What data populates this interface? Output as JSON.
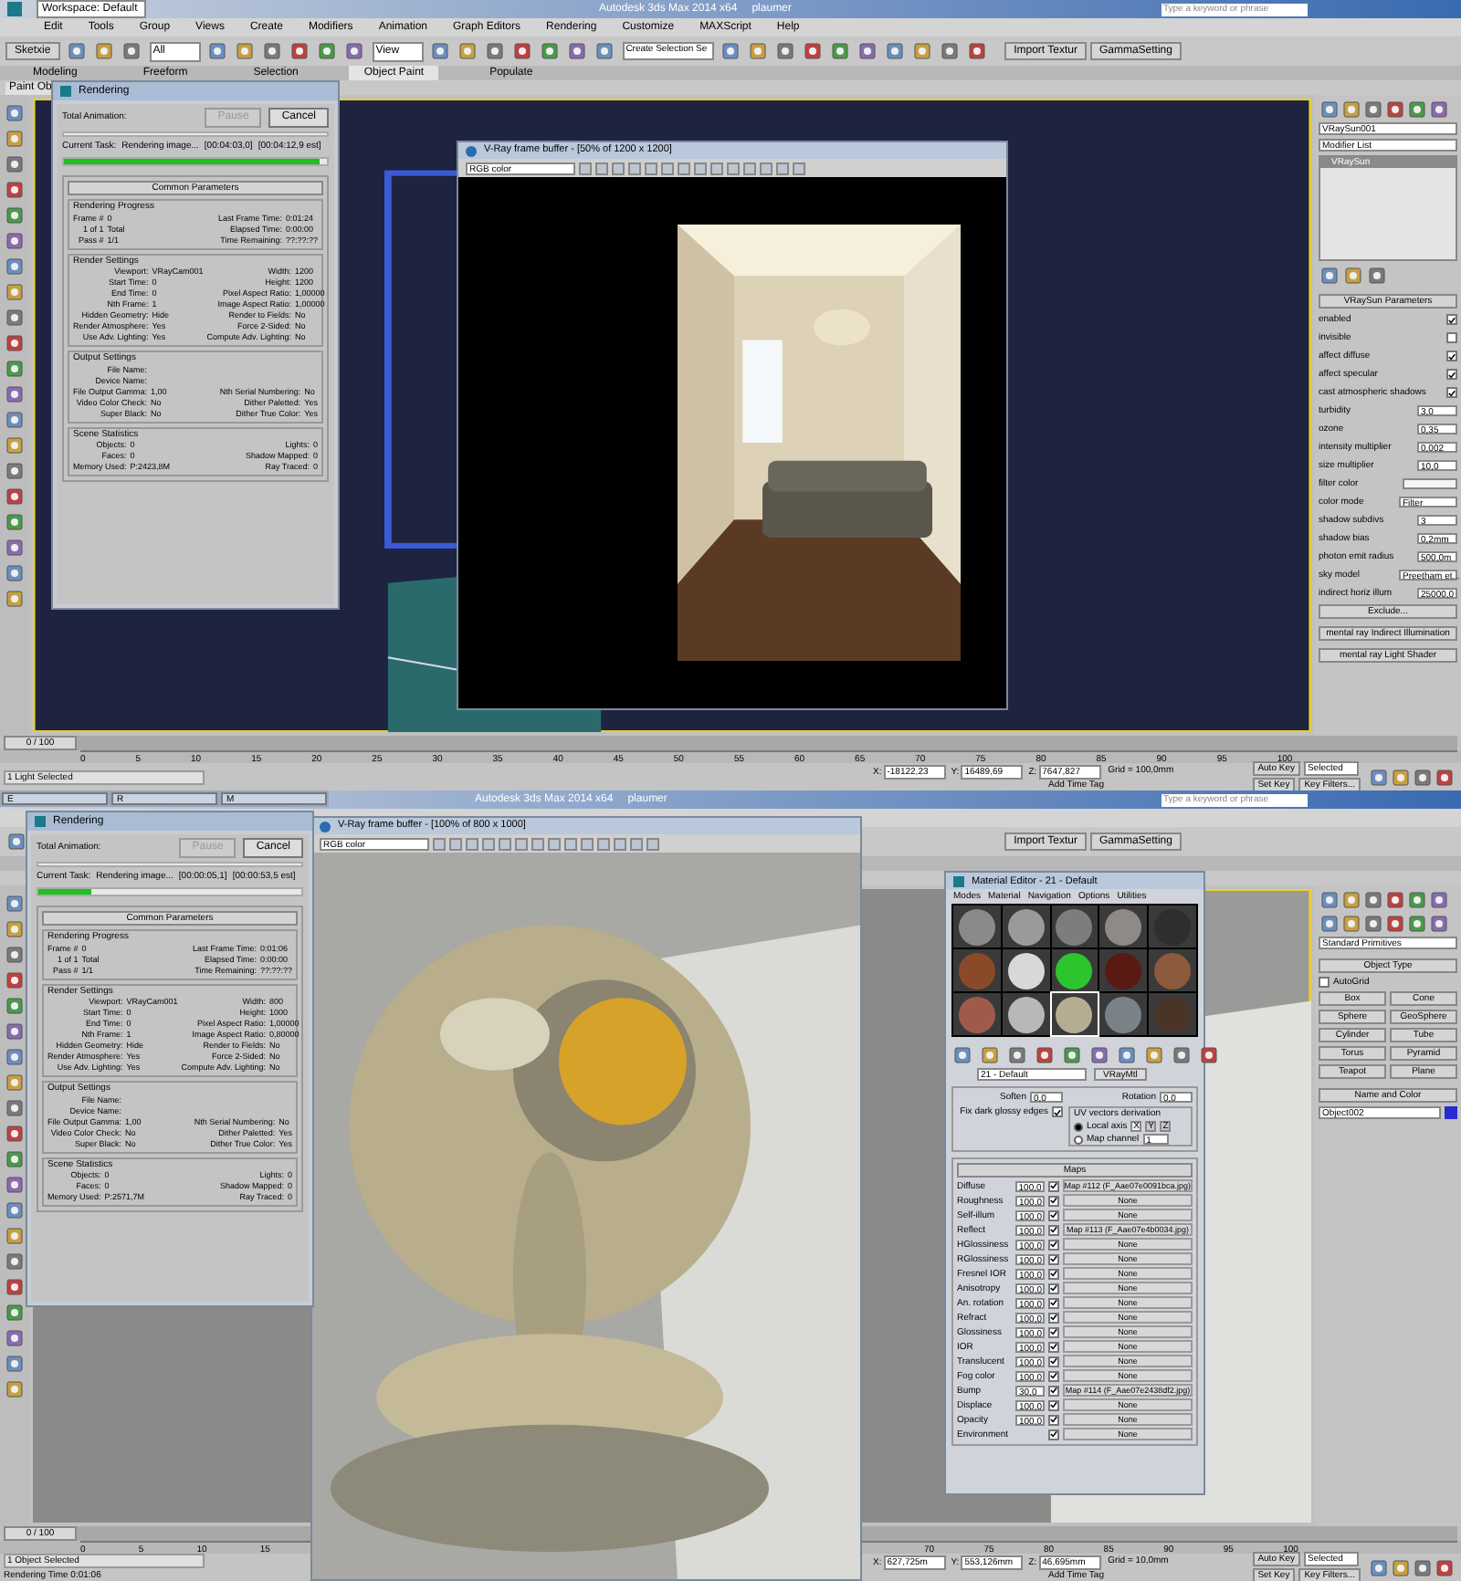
{
  "halves": [
    {
      "title_bar": {
        "workspace": "Workspace: Default",
        "title": "Autodesk 3ds Max 2014 x64",
        "user": "plaumer",
        "search_placeholder": "Type a keyword or phrase"
      },
      "menu": [
        "Edit",
        "Tools",
        "Group",
        "Views",
        "Create",
        "Modifiers",
        "Animation",
        "Graph Editors",
        "Rendering",
        "Customize",
        "MAXScript",
        "Help"
      ],
      "toolbar": {
        "sketch": "Sketxie",
        "filter": "All",
        "view": "View",
        "selection_set": "Create Selection Se",
        "buttons": [
          "Import Textur",
          "GammaSetting"
        ]
      },
      "ribbon": [
        {
          "label": "Modeling",
          "selected": false
        },
        {
          "label": "Freeform",
          "selected": false
        },
        {
          "label": "Selection",
          "selected": false
        },
        {
          "label": "Object Paint",
          "selected": true
        },
        {
          "label": "Populate",
          "selected": false
        }
      ],
      "paint_label": "Paint Ob",
      "viewport": {
        "kind": "dark"
      },
      "render_dialog": {
        "title": "Rendering",
        "total": "Total Animation:",
        "pause": {
          "label": "Pause",
          "disabled": true
        },
        "cancel": "Cancel",
        "task_label": "Current Task:",
        "task": "Rendering image...",
        "total_bar": {
          "level": 0
        },
        "elapsed": "[00:04:03,0]",
        "estimate": "[00:04:12,9 est]",
        "progress": {
          "level": 0.97
        },
        "heading": "Common Parameters",
        "groups": [
          {
            "title": "Rendering Progress",
            "rows": [
              [
                "Frame #",
                "0",
                "Last Frame Time:",
                "0:01:24"
              ],
              [
                "1 of 1",
                "Total",
                "Elapsed Time:",
                "0:00:00"
              ],
              [
                "Pass #",
                "1/1",
                "Time Remaining:",
                "??:??:??"
              ]
            ]
          },
          {
            "title": "Render Settings",
            "rows": [
              [
                "Viewport:",
                "VRayCam001",
                "Width:",
                "1200"
              ],
              [
                "Start Time:",
                "0",
                "Height:",
                "1200"
              ],
              [
                "End Time:",
                "0",
                "Pixel Aspect Ratio:",
                "1,00000"
              ],
              [
                "Nth Frame:",
                "1",
                "Image Aspect Ratio:",
                "1,00000"
              ],
              [
                "Hidden Geometry:",
                "Hide",
                "Render to Fields:",
                "No"
              ],
              [
                "Render Atmosphere:",
                "Yes",
                "Force 2-Sided:",
                "No"
              ],
              [
                "Use Adv. Lighting:",
                "Yes",
                "Compute Adv. Lighting:",
                "No"
              ]
            ]
          },
          {
            "title": "Output Settings",
            "rows": [
              [
                "File Name:"
              ],
              [
                "Device Name:"
              ],
              [
                "File Output Gamma:",
                "1,00",
                "Nth Serial Numbering:",
                "No"
              ],
              [
                "Video Color Check:",
                "No",
                "Dither Paletted:",
                "Yes"
              ],
              [
                "Super Black:",
                "No",
                "Dither True Color:",
                "Yes"
              ]
            ]
          },
          {
            "title": "Scene Statistics",
            "rows": [
              [
                "Objects:",
                "0",
                "Lights:",
                "0"
              ],
              [
                "Faces:",
                "0",
                "Shadow Mapped:",
                "0"
              ],
              [
                "Memory Used:",
                "P:2423,8M",
                "Ray Traced:",
                "0"
              ]
            ]
          }
        ]
      },
      "frame_buffer": {
        "title": "V-Ray frame buffer - [50% of 1200 x 1200]",
        "channel": "RGB color",
        "picture": {
          "kind": "room"
        }
      },
      "command_panel": {
        "kind": "modify",
        "name": "VRaySun001",
        "modifier_list": "Modifier List",
        "stack": [
          "VRaySun"
        ],
        "rollout": "VRaySun Parameters",
        "params": [
          {
            "kind": "check",
            "label": "enabled",
            "checked": true
          },
          {
            "kind": "check",
            "label": "invisible",
            "checked": false
          },
          {
            "kind": "check",
            "label": "affect diffuse",
            "checked": true
          },
          {
            "kind": "check",
            "label": "affect specular",
            "checked": true
          },
          {
            "kind": "check",
            "label": "cast atmospheric shadows",
            "checked": true
          },
          {
            "kind": "spinner",
            "label": "turbidity",
            "value": "3,0"
          },
          {
            "kind": "spinner",
            "label": "ozone",
            "value": "0,35"
          },
          {
            "kind": "spinner",
            "label": "intensity multiplier",
            "value": "0,002"
          },
          {
            "kind": "spinner",
            "label": "size multiplier",
            "value": "10,0"
          },
          {
            "kind": "color",
            "label": "filter color",
            "color": "#f4f4f4"
          },
          {
            "kind": "dropdown",
            "label": "color mode",
            "value": "Filter"
          },
          {
            "kind": "spinner",
            "label": "shadow subdivs",
            "value": "3"
          },
          {
            "kind": "spinner",
            "label": "shadow bias",
            "value": "0,2mm"
          },
          {
            "kind": "spinner",
            "label": "photon emit radius",
            "value": "500,0m"
          },
          {
            "kind": "dropdown",
            "label": "sky model",
            "value": "Preetham et..."
          },
          {
            "kind": "spinner",
            "label": "indirect horiz illum",
            "value": "25000,0"
          }
        ],
        "exclude": "Exclude...",
        "rollouts": [
          "mental ray Indirect Illumination",
          "mental ray Light Shader"
        ]
      },
      "timeline": {
        "position": "0 / 100",
        "level": 0,
        "segments": [
          [
            "0",
            "5",
            "10",
            "15",
            "20",
            "25",
            "30",
            "35",
            "40",
            "45",
            "50",
            "55",
            "60",
            "65",
            "70",
            "75",
            "80",
            "85",
            "90",
            "95",
            "100"
          ]
        ]
      },
      "status": {
        "selection": "1 Light Selected",
        "coords": [
          {
            "axis": "X:",
            "value": "-18122,23"
          },
          {
            "axis": "Y:",
            "value": "16489,69"
          },
          {
            "axis": "Z:",
            "value": "7647,827"
          }
        ],
        "grid": "Grid = 100,0mm",
        "auto_key": "Auto Key",
        "key_mode": "Selected",
        "set_key": "Set Key",
        "key_filters": "Key Filters...",
        "add_time_tag": "Add Time Tag"
      }
    },
    {
      "taskbar": [
        "E",
        "R",
        "M"
      ],
      "title_bar": {
        "title": "Autodesk 3ds Max 2014 x64",
        "user": "plaumer",
        "search_placeholder": "Type a keyword or phrase"
      },
      "toolbar": {
        "buttons": [
          "Import Textur",
          "GammaSetting"
        ]
      },
      "viewport": {
        "kind": "light"
      },
      "render_dialog": {
        "title": "Rendering",
        "total": "Total Animation:",
        "pause": {
          "label": "Pause",
          "disabled": true
        },
        "cancel": "Cancel",
        "task_label": "Current Task:",
        "task": "Rendering image...",
        "total_bar": {
          "level": 0
        },
        "elapsed": "[00:00:05,1]",
        "estimate": "[00:00:53,5 est]",
        "progress": {
          "level": 0.2
        },
        "heading": "Common Parameters",
        "groups": [
          {
            "title": "Rendering Progress",
            "rows": [
              [
                "Frame #",
                "0",
                "Last Frame Time:",
                "0:01:06"
              ],
              [
                "1 of 1",
                "Total",
                "Elapsed Time:",
                "0:00:00"
              ],
              [
                "Pass #",
                "1/1",
                "Time Remaining:",
                "??:??:??"
              ]
            ]
          },
          {
            "title": "Render Settings",
            "rows": [
              [
                "Viewport:",
                "VRayCam001",
                "Width:",
                "800"
              ],
              [
                "Start Time:",
                "0",
                "Height:",
                "1000"
              ],
              [
                "End Time:",
                "0",
                "Pixel Aspect Ratio:",
                "1,00000"
              ],
              [
                "Nth Frame:",
                "1",
                "Image Aspect Ratio:",
                "0,80000"
              ],
              [
                "Hidden Geometry:",
                "Hide",
                "Render to Fields:",
                "No"
              ],
              [
                "Render Atmosphere:",
                "Yes",
                "Force 2-Sided:",
                "No"
              ],
              [
                "Use Adv. Lighting:",
                "Yes",
                "Compute Adv. Lighting:",
                "No"
              ]
            ]
          },
          {
            "title": "Output Settings",
            "rows": [
              [
                "File Name:"
              ],
              [
                "Device Name:"
              ],
              [
                "File Output Gamma:",
                "1,00",
                "Nth Serial Numbering:",
                "No"
              ],
              [
                "Video Color Check:",
                "No",
                "Dither Paletted:",
                "Yes"
              ],
              [
                "Super Black:",
                "No",
                "Dither True Color:",
                "Yes"
              ]
            ]
          },
          {
            "title": "Scene Statistics",
            "rows": [
              [
                "Objects:",
                "0",
                "Lights:",
                "0"
              ],
              [
                "Faces:",
                "0",
                "Shadow Mapped:",
                "0"
              ],
              [
                "Memory Used:",
                "P:2571,7M",
                "Ray Traced:",
                "0"
              ]
            ]
          }
        ]
      },
      "frame_buffer": {
        "title": "V-Ray frame buffer - [100% of 800 x 1000]",
        "channel": "RGB color",
        "picture": {
          "kind": "sphere"
        }
      },
      "material_editor": {
        "title": "Material Editor - 21 - Default",
        "menu": [
          "Modes",
          "Material",
          "Navigation",
          "Options",
          "Utilities"
        ],
        "slots": [
          {
            "color": "#8a8a8a",
            "selected": false
          },
          {
            "color": "#9a9a9a",
            "selected": false
          },
          {
            "color": "#7d7d7d",
            "selected": false
          },
          {
            "color": "#8f8a86",
            "selected": false
          },
          {
            "color": "#2e2e2e",
            "selected": false
          },
          {
            "color": "#8a4a2a",
            "selected": false
          },
          {
            "color": "#d8d8d8",
            "selected": false
          },
          {
            "color": "#2ec42e",
            "selected": false
          },
          {
            "color": "#5a1a14",
            "selected": false
          },
          {
            "color": "#8c5a3c",
            "selected": false
          },
          {
            "color": "#a05a4a",
            "selected": false
          },
          {
            "color": "#b8b8b8",
            "selected": false
          },
          {
            "color": "#b4ad92",
            "selected": true
          },
          {
            "color": "#7a8288",
            "selected": false
          },
          {
            "color": "#4a3428",
            "selected": false
          }
        ],
        "material": "21 - Default",
        "type": "VRayMtl",
        "soften_label": "Soften",
        "soften": "0,0",
        "rotation_label": "Rotation",
        "rotation": "0,0",
        "fix_label": "Fix dark glossy edges",
        "fix": true,
        "uv_title": "UV vectors derivation",
        "uv": [
          {
            "label": "Local axis",
            "selected": true
          },
          {
            "label": "Map channel",
            "selected": false
          }
        ],
        "axes": [
          {
            "label": "X",
            "selected": true
          },
          {
            "label": "Y",
            "selected": false
          },
          {
            "label": "Z",
            "selected": false
          }
        ],
        "map_channel": "1",
        "maps_title": "Maps",
        "maps": [
          {
            "name": "Diffuse",
            "amount": "100,0",
            "checked": true,
            "map": "Map #112 (F_Aae07e0091bca.jpg)"
          },
          {
            "name": "Roughness",
            "amount": "100,0",
            "checked": true,
            "map": "None"
          },
          {
            "name": "Self-illum",
            "amount": "100,0",
            "checked": true,
            "map": "None"
          },
          {
            "name": "Reflect",
            "amount": "100,0",
            "checked": true,
            "map": "Map #113 (F_Aae07e4b0034.jpg)"
          },
          {
            "name": "HGlossiness",
            "amount": "100,0",
            "checked": true,
            "map": "None"
          },
          {
            "name": "RGlossiness",
            "amount": "100,0",
            "checked": true,
            "map": "None"
          },
          {
            "name": "Fresnel IOR",
            "amount": "100,0",
            "checked": true,
            "map": "None"
          },
          {
            "name": "Anisotropy",
            "amount": "100,0",
            "checked": true,
            "map": "None"
          },
          {
            "name": "An. rotation",
            "amount": "100,0",
            "checked": true,
            "map": "None"
          },
          {
            "name": "Refract",
            "amount": "100,0",
            "checked": true,
            "map": "None"
          },
          {
            "name": "Glossiness",
            "amount": "100,0",
            "checked": true,
            "map": "None"
          },
          {
            "name": "IOR",
            "amount": "100,0",
            "checked": true,
            "map": "None"
          },
          {
            "name": "Translucent",
            "amount": "100,0",
            "checked": true,
            "map": "None"
          },
          {
            "name": "Fog color",
            "amount": "100,0",
            "checked": true,
            "map": "None"
          },
          {
            "name": "Bump",
            "amount": "30,0",
            "checked": true,
            "map": "Map #114 (F_Aae07e2438df2.jpg)"
          },
          {
            "name": "Displace",
            "amount": "100,0",
            "checked": true,
            "map": "None"
          },
          {
            "name": "Opacity",
            "amount": "100,0",
            "checked": true,
            "map": "None"
          },
          {
            "name": "Environment",
            "checked": true,
            "map": "None"
          }
        ]
      },
      "command_panel": {
        "kind": "create",
        "category": "Standard Primitives",
        "rollout": "Object Type",
        "autogrid": {
          "label": "AutoGrid",
          "checked": false
        },
        "buttons": [
          "Box",
          "Cone",
          "Sphere",
          "GeoSphere",
          "Cylinder",
          "Tube",
          "Torus",
          "Pyramid",
          "Teapot",
          "Plane"
        ],
        "name_rollout": "Name and Color",
        "name": "Object002",
        "color": "#2a2ad2"
      },
      "timeline": {
        "position": "0 / 100",
        "level": 0,
        "segments": [
          [
            "0",
            "5",
            "10",
            "15"
          ],
          [
            "70",
            "75",
            "80",
            "85",
            "90",
            "95",
            "100"
          ]
        ]
      },
      "status": {
        "selection": "1 Object Selected",
        "message": "Rendering Time 0:01:06",
        "coords": [
          {
            "axis": "X:",
            "value": "627,725m"
          },
          {
            "axis": "Y:",
            "value": "553,126mm"
          },
          {
            "axis": "Z:",
            "value": "46,695mm"
          }
        ],
        "grid": "Grid = 10,0mm",
        "auto_key": "Auto Key",
        "key_mode": "Selected",
        "set_key": "Set Key",
        "key_filters": "Key Filters...",
        "add_time_tag": "Add Time Tag"
      }
    }
  ]
}
